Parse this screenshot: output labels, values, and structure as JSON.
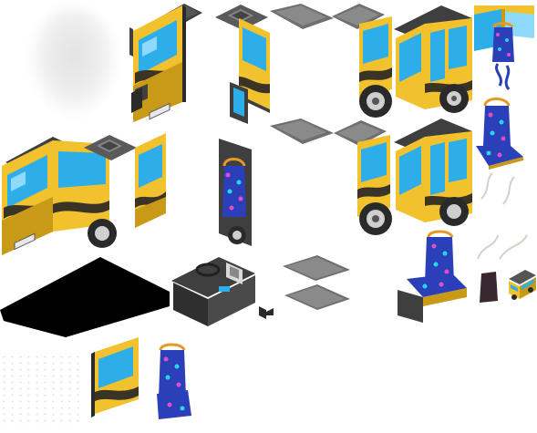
{
  "sheet": {
    "background": "#ffffff",
    "sprite_count": 24
  },
  "palette": {
    "bus_yellow": "#f2c12e",
    "bus_yellow_dark": "#c99a17",
    "bus_stripe": "#3a3426",
    "bus_dark": "#3f3f3f",
    "window_blue": "#2eaee8",
    "window_blue_light": "#8fd9fb",
    "seat_blue": "#2a3fb8",
    "seat_pattern_pink": "#e04fc8",
    "seat_pattern_cyan": "#27d6f0",
    "seat_frame_orange": "#e59a28",
    "tile_gray": "#6f6f6f",
    "tile_gray_light": "#8a8a8a",
    "shadow_black": "#000000",
    "tire_black": "#2a2a2a",
    "rim_silver": "#cfcfcf"
  },
  "sprites": [
    {
      "name": "smoke-cloud-sprite",
      "kind": "smoke"
    },
    {
      "name": "bus-front-cab-sprite",
      "kind": "bus-front"
    },
    {
      "name": "roof-hatch-sprite-1",
      "kind": "roof-hatch"
    },
    {
      "name": "roof-tile-sprite-1",
      "kind": "tile"
    },
    {
      "name": "roof-tile-sprite-2",
      "kind": "tile"
    },
    {
      "name": "bus-side-window-sprite-1",
      "kind": "bus-side"
    },
    {
      "name": "bus-rear-cab-sprite-1",
      "kind": "bus-rear"
    },
    {
      "name": "bus-corner-window-sprite",
      "kind": "corner-window"
    },
    {
      "name": "bus-seat-sprite-1",
      "kind": "seat"
    },
    {
      "name": "bus-wheel-sprite-1",
      "kind": "wheel"
    },
    {
      "name": "bus-front-full-sprite",
      "kind": "bus-front-large"
    },
    {
      "name": "roof-hatch-sprite-2",
      "kind": "roof-hatch"
    },
    {
      "name": "bus-side-segment-sprite",
      "kind": "bus-side"
    },
    {
      "name": "bus-seat-sprite-2",
      "kind": "seat"
    },
    {
      "name": "roof-tile-sprite-3",
      "kind": "tile"
    },
    {
      "name": "bus-side-window-sprite-2",
      "kind": "bus-side"
    },
    {
      "name": "bus-rear-cab-sprite-2",
      "kind": "bus-rear"
    },
    {
      "name": "bus-seat-sprite-3",
      "kind": "seat"
    },
    {
      "name": "bus-shadow-sprite",
      "kind": "shadow"
    },
    {
      "name": "driver-console-sprite",
      "kind": "console"
    },
    {
      "name": "floor-tile-sprite",
      "kind": "tile"
    },
    {
      "name": "bus-seat-sprite-4",
      "kind": "seat"
    },
    {
      "name": "bus-mini-icon-sprite",
      "kind": "mini-bus"
    },
    {
      "name": "bus-door-sprite",
      "kind": "door"
    }
  ]
}
